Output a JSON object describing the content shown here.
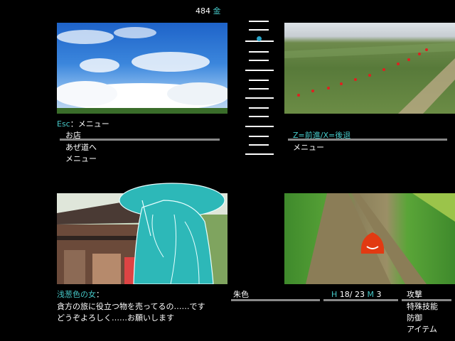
{
  "status": {
    "money": "484",
    "currency": "金"
  },
  "top_left": {
    "hint_key": "Esc",
    "hint_text": "：メニュー",
    "options": [
      "お店",
      "あぜ道へ",
      "メニュー"
    ]
  },
  "top_right": {
    "hint_text": "Z=前進/X=後退",
    "menu_label": "メニュー"
  },
  "dialog": {
    "speaker": "浅葱色の女",
    "speaker_suffix": "：",
    "line1": "貪方の旅に役立つ物を売ってるの……です",
    "line2": "どうぞよろしく……お願いします"
  },
  "enemy_panel": {
    "name": "朱色"
  },
  "stats": {
    "h_label": "H",
    "h_value": "18/ 23",
    "m_label": "M",
    "m_value": "3"
  },
  "commands": [
    "攻撃",
    "特殊技能",
    "防御",
    "アイテム"
  ],
  "colors": {
    "accent": "#46c8c8",
    "enemy": "#e23a12",
    "ghost": "#2db8b8"
  }
}
